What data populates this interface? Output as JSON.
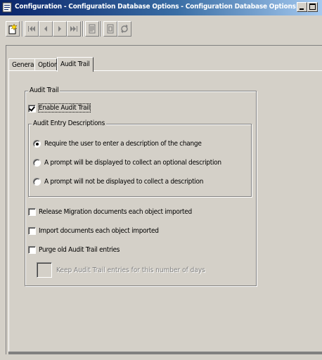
{
  "window": {
    "title": "Configuration - Configuration Database Options - Configuration Database Options"
  },
  "toolbar": {
    "buttons": [
      {
        "icon": "new-record-icon"
      },
      {
        "icon": "first-record-icon"
      },
      {
        "icon": "previous-record-icon"
      },
      {
        "icon": "next-record-icon"
      },
      {
        "icon": "last-record-icon"
      },
      {
        "icon": "print-icon"
      },
      {
        "icon": "properties-icon"
      },
      {
        "icon": "refresh-icon"
      }
    ]
  },
  "tabs": [
    {
      "label": "General",
      "active": false
    },
    {
      "label": "Options",
      "active": false
    },
    {
      "label": "Audit Trail",
      "active": true
    }
  ],
  "audit_trail": {
    "group_label": "Audit Trail",
    "enable_label": "Enable Audit Trail",
    "enable_checked": true,
    "descriptions_group_label": "Audit Entry Descriptions",
    "options": [
      {
        "label": "Require the user to enter a description of the change",
        "selected": true
      },
      {
        "label": "A prompt will be displayed to collect an optional description",
        "selected": false
      },
      {
        "label": "A prompt will not be displayed to collect a description",
        "selected": false
      }
    ],
    "release_label": "Release Migration documents each object imported",
    "release_checked": false,
    "import_label": "Import documents each object imported",
    "import_checked": false,
    "purge_label": "Purge old Audit Trail entries",
    "purge_checked": false,
    "keep_days_value": "",
    "keep_days_label": "Keep Audit Trail entries for this number of days"
  }
}
